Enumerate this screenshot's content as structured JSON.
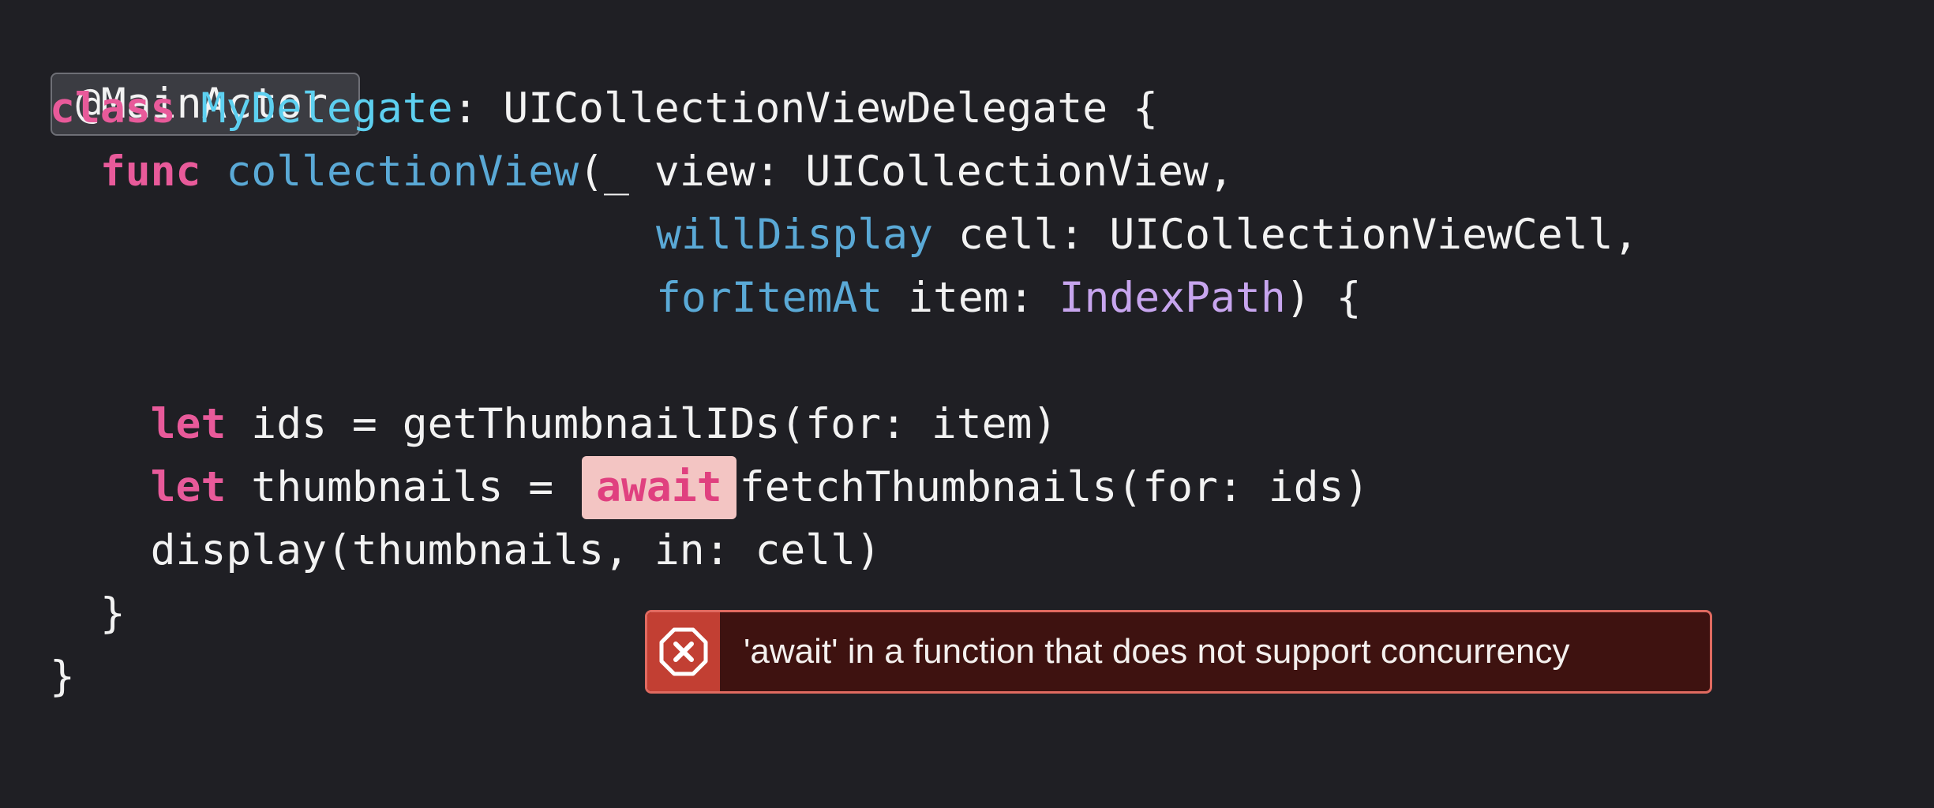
{
  "code": {
    "attribute": "@MainActor",
    "line1": {
      "keyword": "class",
      "type_name": "MyDelegate",
      "rest": ": UICollectionViewDelegate {"
    },
    "line2": {
      "keyword": "func",
      "func_name": "collectionView",
      "rest": "(_ view: UICollectionView,"
    },
    "line3": {
      "label": "willDisplay",
      "rest": " cell: UICollectionViewCell,"
    },
    "line4": {
      "label": "forItemAt",
      "middle": " item: ",
      "type_ref": "IndexPath",
      "rest": ") {"
    },
    "line5": {
      "keyword": "let",
      "rest": " ids = getThumbnailIDs(for: item)"
    },
    "line6": {
      "keyword": "let",
      "before_await": " thumbnails = ",
      "await": "await",
      "after_await": "fetchThumbnails(for: ids)"
    },
    "line7": {
      "text": "display(thumbnails, in: cell)"
    },
    "line8": {
      "text": "}"
    },
    "line9": {
      "text": "}"
    }
  },
  "error": {
    "icon": "x-octagon-icon",
    "message": "'await' in a function that does not support concurrency",
    "accent_color": "#c23f33",
    "background_color": "#3e1210"
  },
  "colors": {
    "background": "#1f1f24",
    "keyword": "#e85a9a",
    "type_declaration": "#5dd0f0",
    "function_declaration": "#5aa9d6",
    "type_reference": "#c7a5ee",
    "plain_text": "#f2f2f2",
    "await_highlight": "#f3c5c3"
  }
}
